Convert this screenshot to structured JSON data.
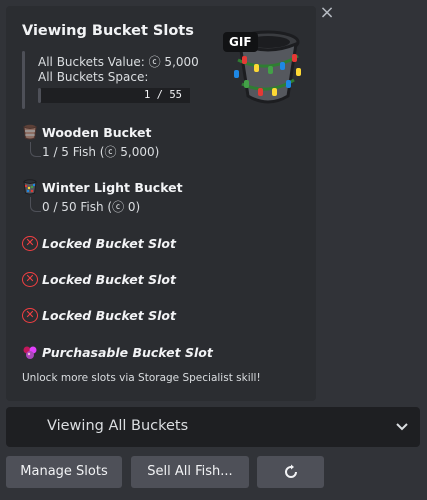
{
  "close_label": "×",
  "embed": {
    "title": "Viewing Bucket Slots",
    "value_line": "All Buckets Value: ⓒ 5,000",
    "space_line": "All Buckets Space:",
    "space_progress": 0.018,
    "space_text": "1 / 55",
    "thumbnail_badge": "GIF",
    "buckets": [
      {
        "title": "Wooden Bucket",
        "subtitle": "1 / 5 Fish (ⓒ 5,000)",
        "icon": "wooden-bucket-icon"
      },
      {
        "title": "Winter Light Bucket",
        "subtitle": "0 / 50 Fish (ⓒ 0)",
        "icon": "winter-light-bucket-icon"
      }
    ],
    "locked_slots": [
      "Locked Bucket Slot",
      "Locked Bucket Slot",
      "Locked Bucket Slot"
    ],
    "purchasable_label": "Purchasable Bucket Slot",
    "footer_note": "Unlock more slots via Storage Specialist skill!"
  },
  "select": {
    "value": "Viewing All Buckets"
  },
  "buttons": {
    "manage": "Manage Slots",
    "sell": "Sell All Fish..."
  },
  "colors": {
    "accent_red": "#f23f42",
    "background": "#313338",
    "embed_bg": "#2b2d31",
    "button": "#4e5058"
  }
}
